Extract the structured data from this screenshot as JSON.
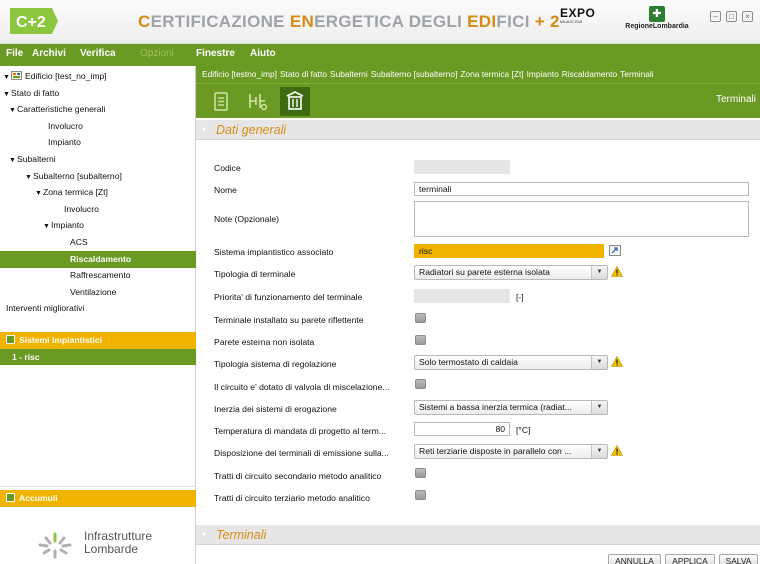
{
  "titlebar": {
    "logo_text": "C+2",
    "title_parts": [
      {
        "text": "C",
        "hl": true
      },
      {
        "text": "ERTIFICAZIONE ",
        "hl": false
      },
      {
        "text": "EN",
        "hl": true
      },
      {
        "text": "ERGETICA DEGLI ",
        "hl": false
      },
      {
        "text": "EDI",
        "hl": true
      },
      {
        "text": "FICI",
        "hl": false
      },
      {
        "text": " + 2",
        "hl": true
      }
    ],
    "expo_logo": "EXPO",
    "expo_sub": "MILANO 2015",
    "region_logo": "RegioneLombardia",
    "controls": [
      "minimize-icon",
      "maximize-icon",
      "close-icon"
    ]
  },
  "menu": {
    "items": [
      {
        "label": "File",
        "disabled": false
      },
      {
        "label": "Archivi",
        "disabled": false
      },
      {
        "label": "Verifica",
        "disabled": false
      },
      {
        "label": "Opzioni",
        "disabled": true
      },
      {
        "label": "Finestre",
        "disabled": false
      },
      {
        "label": "Aiuto",
        "disabled": false
      }
    ]
  },
  "sidebar": {
    "tree": [
      {
        "label": "Edificio [test_no_imp]",
        "depth": 0,
        "expanded": true,
        "icon": "building-doc-icon"
      },
      {
        "label": "Stato di fatto",
        "depth": 0,
        "expanded": true
      },
      {
        "label": "Caratteristiche generali",
        "depth": 1,
        "expanded": true
      },
      {
        "label": "Involucro",
        "depth": 2
      },
      {
        "label": "Impianto",
        "depth": 2
      },
      {
        "label": "Subalterni",
        "depth": 1,
        "expanded": true
      },
      {
        "label": "Subalterno [subalterno]",
        "depth": 2,
        "expanded": true
      },
      {
        "label": "Zona termica [Zt]",
        "depth": 3,
        "expanded": true
      },
      {
        "label": "Involucro",
        "depth": 4
      },
      {
        "label": "Impianto",
        "depth": 4,
        "expanded": true
      },
      {
        "label": "ACS",
        "depth": 5
      },
      {
        "label": "Riscaldamento",
        "depth": 5,
        "selected": true
      },
      {
        "label": "Raffrescamento",
        "depth": 5
      },
      {
        "label": "Ventilazione",
        "depth": 5
      },
      {
        "label": "Interventi migliorativi",
        "depth": 0
      }
    ],
    "sistemi": {
      "title": "Sistemi impiantistici",
      "items": [
        "1 - risc"
      ]
    },
    "accumuli": {
      "title": "Accumuli"
    },
    "footer": {
      "line1": "Infrastrutture",
      "line2": "Lombarde"
    }
  },
  "main": {
    "breadcrumb": [
      "Edificio [testno_imp]",
      "Stato di fatto",
      "Subalterni",
      "Subalterno [subalterno]",
      "Zona termica [Zt]",
      "Impianto",
      "Riscaldamento",
      "Terminali"
    ],
    "toolbar": {
      "title": "Terminali",
      "buttons": [
        "list-icon",
        "pipes-icon",
        "radiator-icon"
      ]
    },
    "group_general": {
      "title": "Dati generali"
    },
    "form": {
      "codice": {
        "label": "Codice",
        "value": ""
      },
      "nome": {
        "label": "Nome",
        "value": "terminali"
      },
      "note": {
        "label": "Note (Opzionale)",
        "value": ""
      },
      "sistema": {
        "label": "Sistema impiantistico associato",
        "value": "risc"
      },
      "tipologia_terminale": {
        "label": "Tipologia di terminale",
        "value": "Radiatori su parete esterna isolata"
      },
      "priorita": {
        "label": "Priorita' di funzionamento del terminale",
        "value": "",
        "unit": "[-]"
      },
      "parete_riflettente": {
        "label": "Terminale installato su parete riflettente",
        "checked": false
      },
      "parete_non_isolata": {
        "label": "Parete esterna non isolata",
        "checked": false
      },
      "regolazione": {
        "label": "Tipologia sistema di regolazione",
        "value": "Solo termostato di caldaia"
      },
      "valvola": {
        "label": "Il circuito e' dotato di valvola di miscelazione...",
        "checked": false
      },
      "inerzia": {
        "label": "Inerzia dei sistemi di erogazione",
        "value": "Sistemi a bassa inerzia termica (radiat..."
      },
      "temperatura": {
        "label": "Temperatura di mandata di progetto al term...",
        "value": "80",
        "unit": "[°C]"
      },
      "disposizione": {
        "label": "Disposizione dei terminali di emissione sulla...",
        "value": "Reti terziarie disposte in parallelo con ..."
      },
      "secondario": {
        "label": "Tratti di circuito secondario metodo analitico",
        "checked": false
      },
      "terziario": {
        "label": "Tratti di circuito terziario metodo analitico",
        "checked": false
      }
    },
    "group_terminali": {
      "title": "Terminali"
    },
    "buttons": {
      "annulla": "ANNULLA",
      "applica": "APPLICA",
      "salva": "SALVA"
    }
  },
  "colors": {
    "accent_green": "#6a9a24",
    "dark_green": "#3e6a11",
    "orange": "#f0b400",
    "title_orange": "#d88b13",
    "warning_yellow": "#f2c200"
  }
}
